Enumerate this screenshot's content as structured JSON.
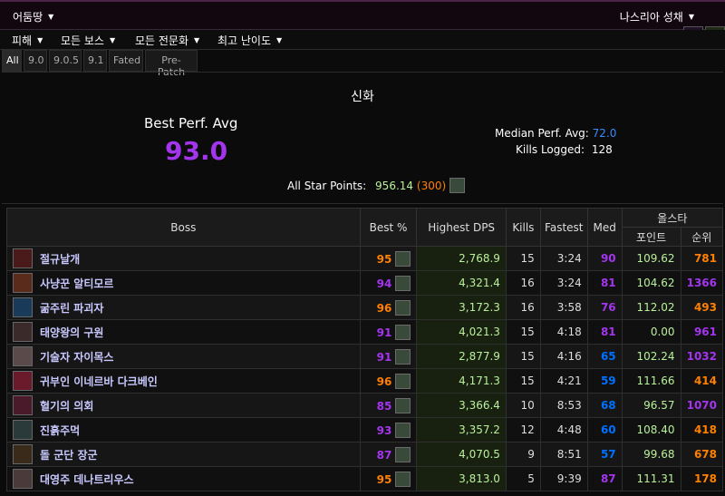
{
  "topbar": {
    "realm": "어둠땅",
    "zone": "나스리아 성채"
  },
  "menu": [
    "피해",
    "모든 보스",
    "모든 전문화",
    "최고 난이도"
  ],
  "tabs": [
    "All",
    "9.0",
    "9.0.5",
    "9.1",
    "Fated",
    "Pre-Patch"
  ],
  "summary": {
    "difficulty": "신화",
    "best_label": "Best Perf. Avg",
    "best_value": "93.0",
    "median_label": "Median Perf. Avg:",
    "median_value": "72.0",
    "kills_label": "Kills Logged:",
    "kills_value": "128",
    "star_label": "All Star Points:",
    "star_points": "956.14",
    "star_rank": "300"
  },
  "table": {
    "headers": {
      "boss": "Boss",
      "best": "Best %",
      "dps": "Highest DPS",
      "kills": "Kills",
      "fastest": "Fastest",
      "med": "Med",
      "allstar": "올스타",
      "points": "포인트",
      "rank": "순위"
    },
    "rows": [
      {
        "boss": "절규날개",
        "best": "95",
        "dps": "2,768.9",
        "kills": "15",
        "fastest": "3:24",
        "med": "90",
        "points": "109.62",
        "rank": "781"
      },
      {
        "boss": "사냥꾼 알티모르",
        "best": "94",
        "dps": "4,321.4",
        "kills": "16",
        "fastest": "3:24",
        "med": "81",
        "points": "104.62",
        "rank": "1366"
      },
      {
        "boss": "굶주린 파괴자",
        "best": "96",
        "dps": "3,172.3",
        "kills": "16",
        "fastest": "3:58",
        "med": "76",
        "points": "112.02",
        "rank": "493"
      },
      {
        "boss": "태양왕의 구원",
        "best": "91",
        "dps": "4,021.3",
        "kills": "15",
        "fastest": "4:18",
        "med": "81",
        "points": "0.00",
        "rank": "961"
      },
      {
        "boss": "기술자 자이목스",
        "best": "91",
        "dps": "2,877.9",
        "kills": "15",
        "fastest": "4:16",
        "med": "65",
        "points": "102.24",
        "rank": "1032"
      },
      {
        "boss": "귀부인 이네르바 다크베인",
        "best": "96",
        "dps": "4,171.3",
        "kills": "15",
        "fastest": "4:21",
        "med": "59",
        "points": "111.66",
        "rank": "414"
      },
      {
        "boss": "혈기의 의회",
        "best": "85",
        "dps": "3,366.4",
        "kills": "10",
        "fastest": "8:53",
        "med": "68",
        "points": "96.57",
        "rank": "1070"
      },
      {
        "boss": "진흙주먹",
        "best": "93",
        "dps": "3,357.2",
        "kills": "12",
        "fastest": "4:48",
        "med": "60",
        "points": "108.40",
        "rank": "418"
      },
      {
        "boss": "돌 군단 장군",
        "best": "87",
        "dps": "4,070.5",
        "kills": "9",
        "fastest": "8:51",
        "med": "57",
        "points": "99.68",
        "rank": "678"
      },
      {
        "boss": "대영주 데나트리우스",
        "best": "95",
        "dps": "3,813.0",
        "kills": "5",
        "fastest": "9:39",
        "med": "87",
        "points": "111.31",
        "rank": "178"
      }
    ]
  }
}
